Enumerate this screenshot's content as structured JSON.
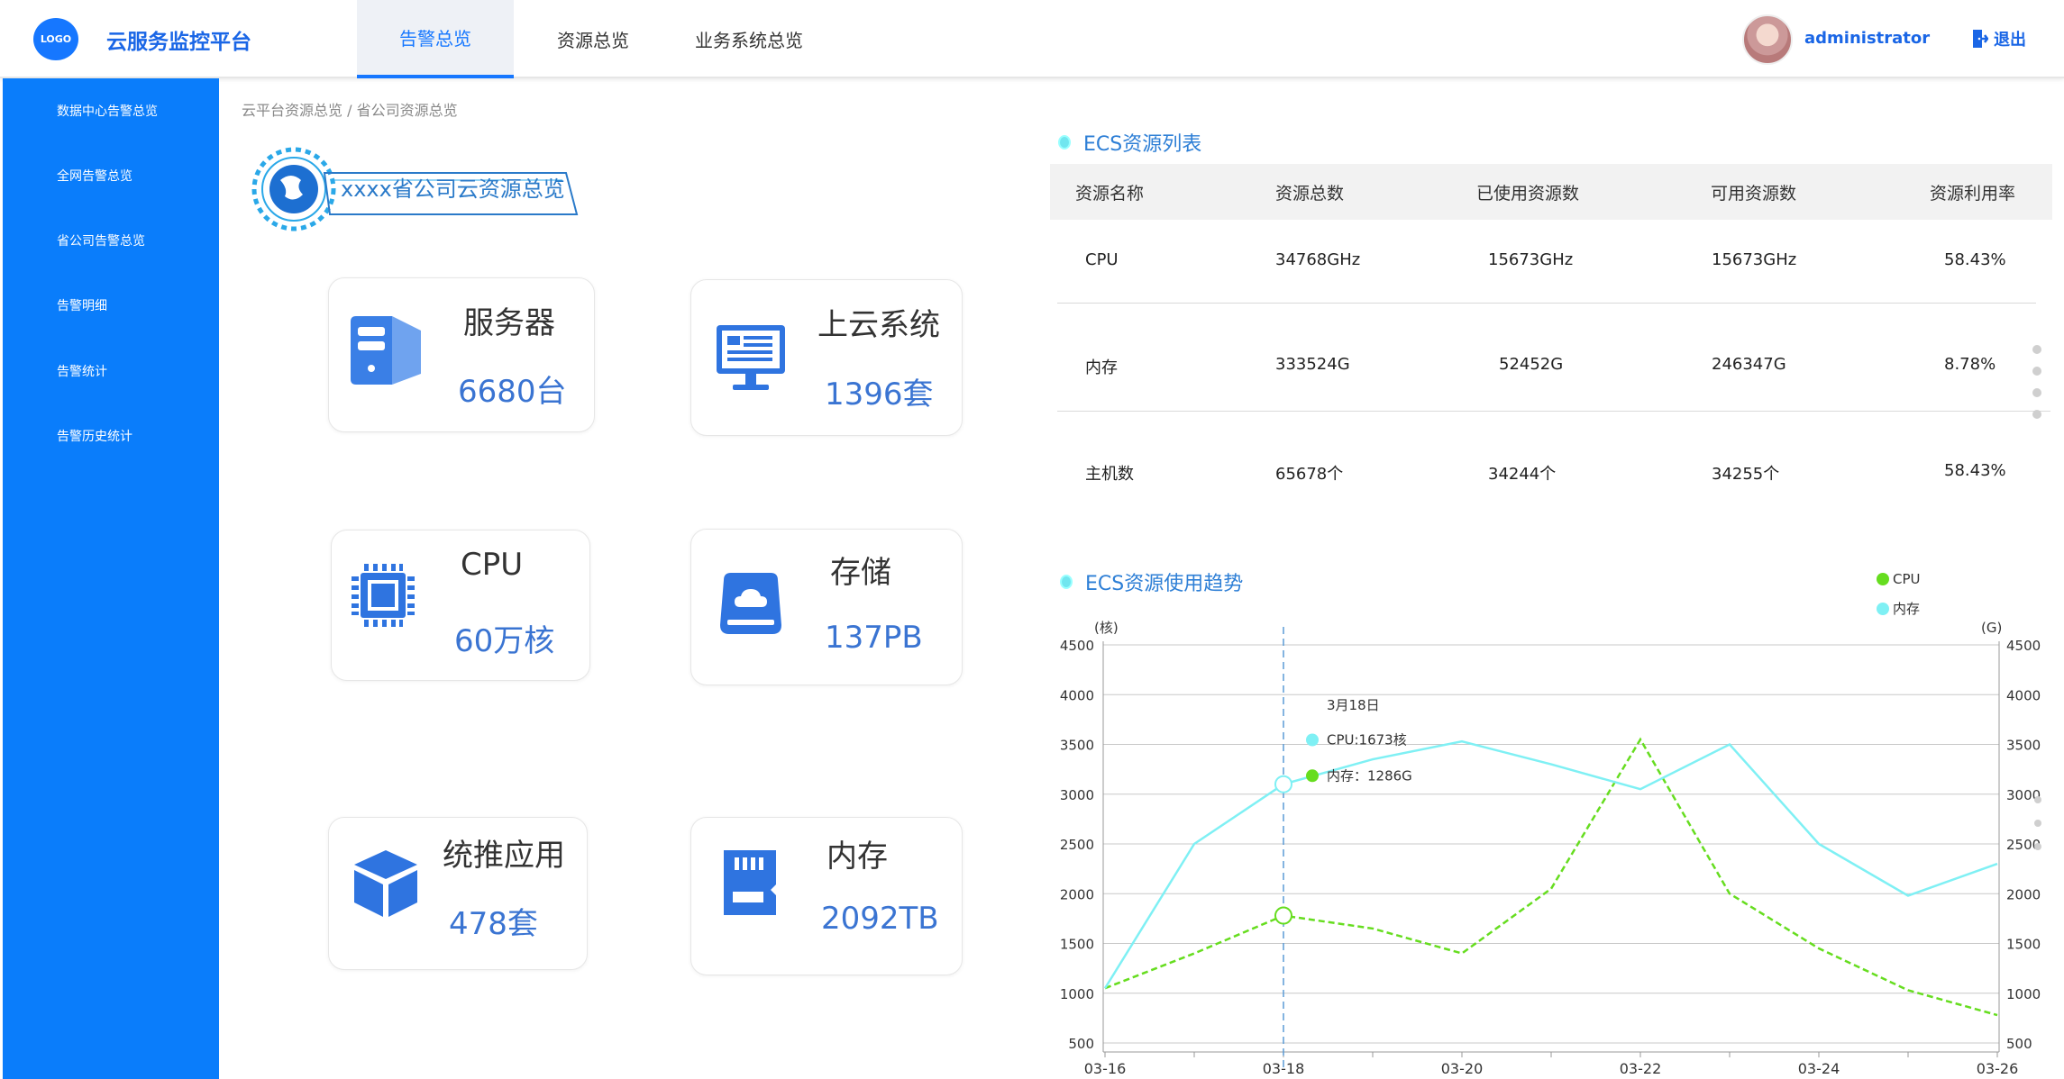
{
  "header": {
    "logo_text": "LOGO",
    "app_title": "云服务监控平台",
    "tabs": [
      {
        "label": "告警总览",
        "active": true
      },
      {
        "label": "资源总览",
        "active": false
      },
      {
        "label": "业务系统总览",
        "active": false
      }
    ],
    "username": "administrator",
    "logout_label": "退出"
  },
  "sidebar": {
    "items": [
      {
        "label": "数据中心告警总览"
      },
      {
        "label": "全网告警总览"
      },
      {
        "label": "省公司告警总览"
      },
      {
        "label": "告警明细"
      },
      {
        "label": "告警统计"
      },
      {
        "label": "告警历史统计"
      }
    ]
  },
  "breadcrumb": "云平台资源总览 / 省公司资源总览",
  "banner_title": "xxxx省公司云资源总览",
  "cards": [
    {
      "label": "服务器",
      "value": "6680台",
      "icon": "server-icon"
    },
    {
      "label": "上云系统",
      "value": "1396套",
      "icon": "monitor-icon"
    },
    {
      "label": "CPU",
      "value": "60万核",
      "icon": "cpu-chip-icon"
    },
    {
      "label": "存储",
      "value": "137PB",
      "icon": "storage-cloud-icon"
    },
    {
      "label": "统推应用",
      "value": "478套",
      "icon": "cube-icon"
    },
    {
      "label": "内存",
      "value": "2092TB",
      "icon": "memory-card-icon"
    }
  ],
  "ecs_table": {
    "title": "ECS资源列表",
    "columns": [
      "资源名称",
      "资源总数",
      "已使用资源数",
      "可用资源数",
      "资源利用率"
    ],
    "rows": [
      [
        "CPU",
        "34768GHz",
        "15673GHz",
        "15673GHz",
        "58.43%"
      ],
      [
        "内存",
        "333524G",
        "52452G",
        "246347G",
        "8.78%"
      ],
      [
        "主机数",
        "65678个",
        "34244个",
        "34255个",
        "58.43%"
      ]
    ]
  },
  "trend": {
    "title": "ECS资源使用趋势",
    "tooltip": {
      "date": "3月18日",
      "cpu_line": "CPU:1673核",
      "mem_line": "内存：1286G"
    }
  },
  "colors": {
    "accent": "#1677ff",
    "sidebar": "#0a7dfb",
    "cpu_series": "#66dd1f",
    "mem_series": "#7ff0f4",
    "value_blue": "#3a74d2"
  },
  "chart_data": {
    "type": "line",
    "x": [
      "03-16",
      "03-17",
      "03-18",
      "03-19",
      "03-20",
      "03-21",
      "03-22",
      "03-23",
      "03-24",
      "03-25",
      "03-26"
    ],
    "x_tick_labels": [
      "03-16",
      "03-18",
      "03-20",
      "03-22",
      "03-24",
      "03-26"
    ],
    "ylabel_left": "(核)",
    "ylabel_right": "(G)",
    "y_ticks": [
      500,
      1000,
      1500,
      2000,
      2500,
      3000,
      3500,
      4000,
      4500
    ],
    "ylim": [
      500,
      4500
    ],
    "grid": true,
    "legend_position": "top-right",
    "series": [
      {
        "name": "CPU",
        "style": "dashed",
        "color": "#66dd1f",
        "values": [
          1050,
          1400,
          1780,
          1650,
          1400,
          2050,
          3550,
          2000,
          1450,
          1030,
          780
        ]
      },
      {
        "name": "内存",
        "style": "solid",
        "color": "#7ff0f4",
        "values": [
          1050,
          2500,
          3100,
          3350,
          3530,
          3300,
          3050,
          3500,
          2500,
          1980,
          2300
        ]
      }
    ],
    "highlight_index": 2
  }
}
